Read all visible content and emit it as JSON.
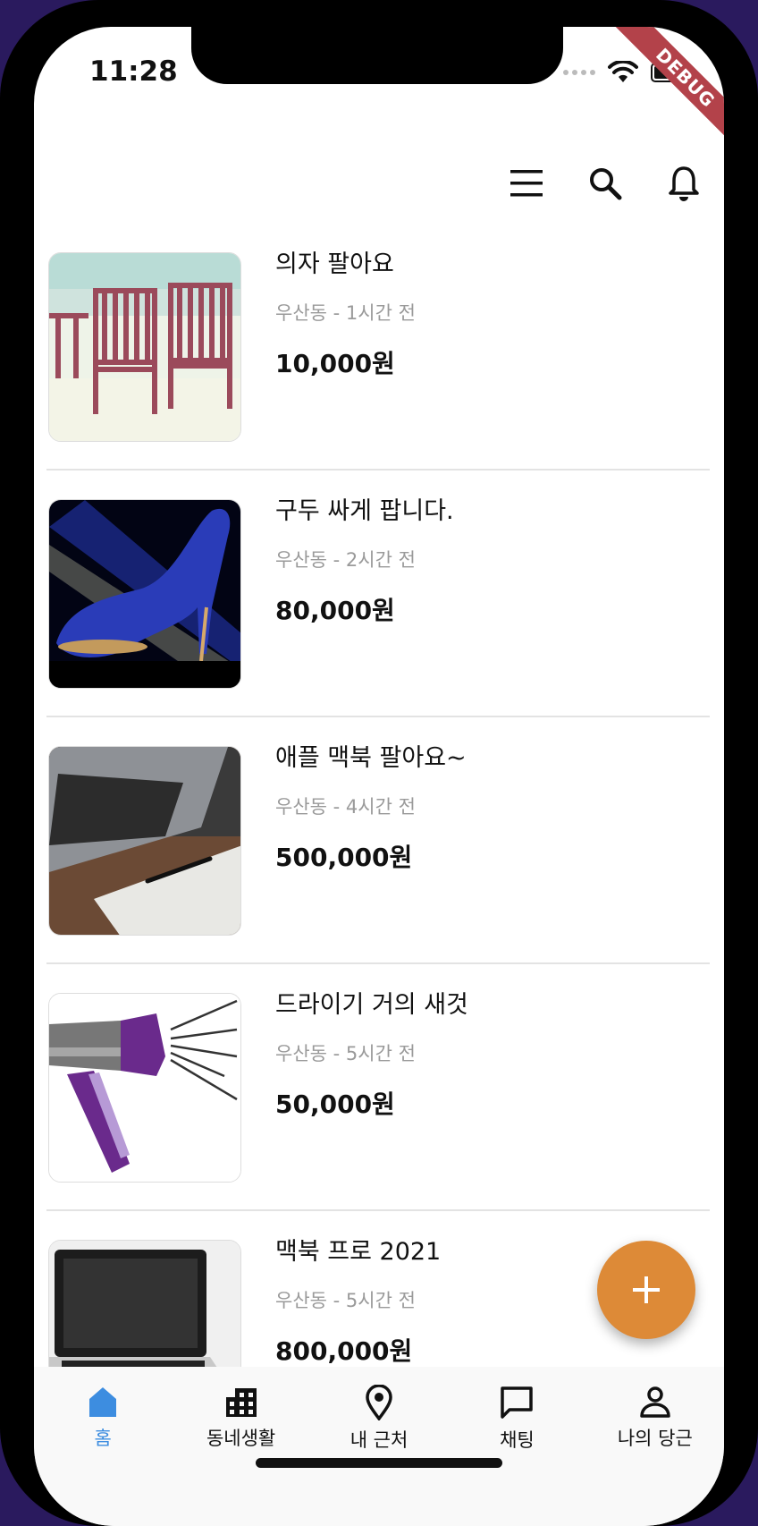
{
  "status_bar": {
    "time": "11:28",
    "debug_label": "DEBUG"
  },
  "appbar": {
    "icons": [
      "menu-icon",
      "search-icon",
      "bell-icon"
    ]
  },
  "products": [
    {
      "title": "의자 팔아요",
      "meta": "우산동 - 1시간 전",
      "price": "10,000원",
      "image": "chairs-on-beach"
    },
    {
      "title": "구두 싸게 팝니다.",
      "meta": "우산동 - 2시간 전",
      "price": "80,000원",
      "image": "blue-high-heel"
    },
    {
      "title": "애플 맥북 팔아요~",
      "meta": "우산동 - 4시간 전",
      "price": "500,000원",
      "image": "laptop-and-tablet"
    },
    {
      "title": "드라이기 거의 새것",
      "meta": "우산동 - 5시간 전",
      "price": "50,000원",
      "image": "purple-hair-dryer"
    },
    {
      "title": "맥북 프로 2021",
      "meta": "우산동 - 5시간 전",
      "price": "800,000원",
      "image": "macbook-pro"
    }
  ],
  "fab": {
    "icon": "plus-icon",
    "color": "#dd8a37"
  },
  "bottom_nav": [
    {
      "label": "홈",
      "icon": "home-icon",
      "active": true
    },
    {
      "label": "동네생활",
      "icon": "building-icon",
      "active": false
    },
    {
      "label": "내 근처",
      "icon": "location-pin-icon",
      "active": false
    },
    {
      "label": "채팅",
      "icon": "chat-bubble-icon",
      "active": false
    },
    {
      "label": "나의 당근",
      "icon": "person-icon",
      "active": false
    }
  ],
  "colors": {
    "active_nav": "#3d8de0",
    "meta_text": "#9a9a9a",
    "divider": "#e3e3e3"
  }
}
